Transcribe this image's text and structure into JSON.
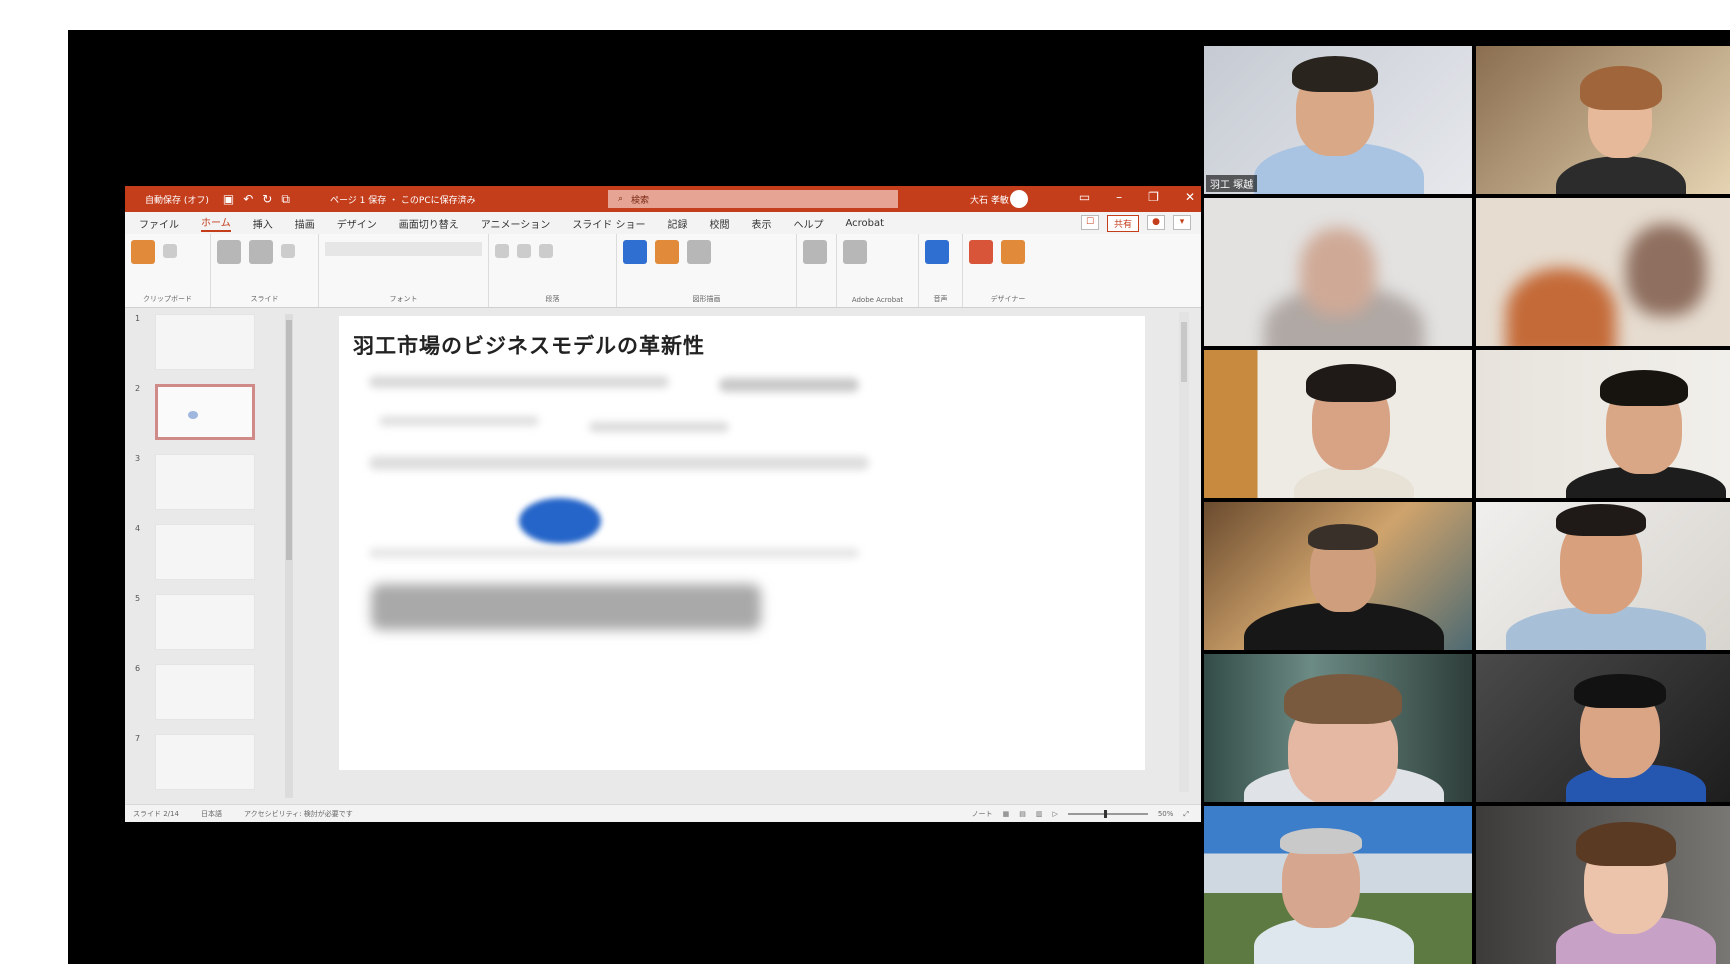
{
  "powerpoint": {
    "titlebar": {
      "autosave": "自動保存 (オフ)",
      "qat_icons": [
        "save-icon",
        "undo-icon",
        "redo-icon",
        "present-icon"
      ],
      "document_title": "ページ 1 保存 ・ このPCに保存済み",
      "search_placeholder": "検索",
      "user_name": "大石 孝敏",
      "window_controls": [
        "ribbon-display-icon",
        "minimize-icon",
        "restore-icon",
        "close-icon"
      ]
    },
    "tabs": [
      "ファイル",
      "ホーム",
      "挿入",
      "描画",
      "デザイン",
      "画面切り替え",
      "アニメーション",
      "スライド ショー",
      "記録",
      "校閲",
      "表示",
      "ヘルプ",
      "Acrobat"
    ],
    "active_tab": "ホーム",
    "share_label": "共有",
    "ribbon_groups": [
      "クリップボード",
      "スライド",
      "フォント",
      "段落",
      "図形描画",
      "Adobe Acrobat",
      "音声",
      "デザイナー"
    ],
    "slide_numbers": [
      "1",
      "2",
      "3",
      "4",
      "5",
      "6",
      "7"
    ],
    "selected_slide": 2,
    "slide_title": "羽工市場のビジネスモデルの革新性",
    "status": {
      "slide_indicator": "スライド 2/14",
      "language": "日本語",
      "accessibility": "アクセシビリティ: 検討が必要です",
      "notes": "ノート",
      "zoom": "50%"
    },
    "colors": {
      "accent": "#c43e1c",
      "slide_shape": "#2565c9"
    }
  },
  "video_grid": {
    "tiles": [
      {
        "id": "p1",
        "name": "羽工 塚越"
      },
      {
        "id": "p2",
        "name": ""
      },
      {
        "id": "p3",
        "name": ""
      },
      {
        "id": "p4",
        "name": ""
      },
      {
        "id": "p5",
        "name": ""
      },
      {
        "id": "p6",
        "name": ""
      },
      {
        "id": "p7",
        "name": ""
      },
      {
        "id": "p8",
        "name": ""
      },
      {
        "id": "p9",
        "name": ""
      },
      {
        "id": "p10",
        "name": ""
      },
      {
        "id": "p11",
        "name": ""
      },
      {
        "id": "p12",
        "name": ""
      }
    ]
  }
}
